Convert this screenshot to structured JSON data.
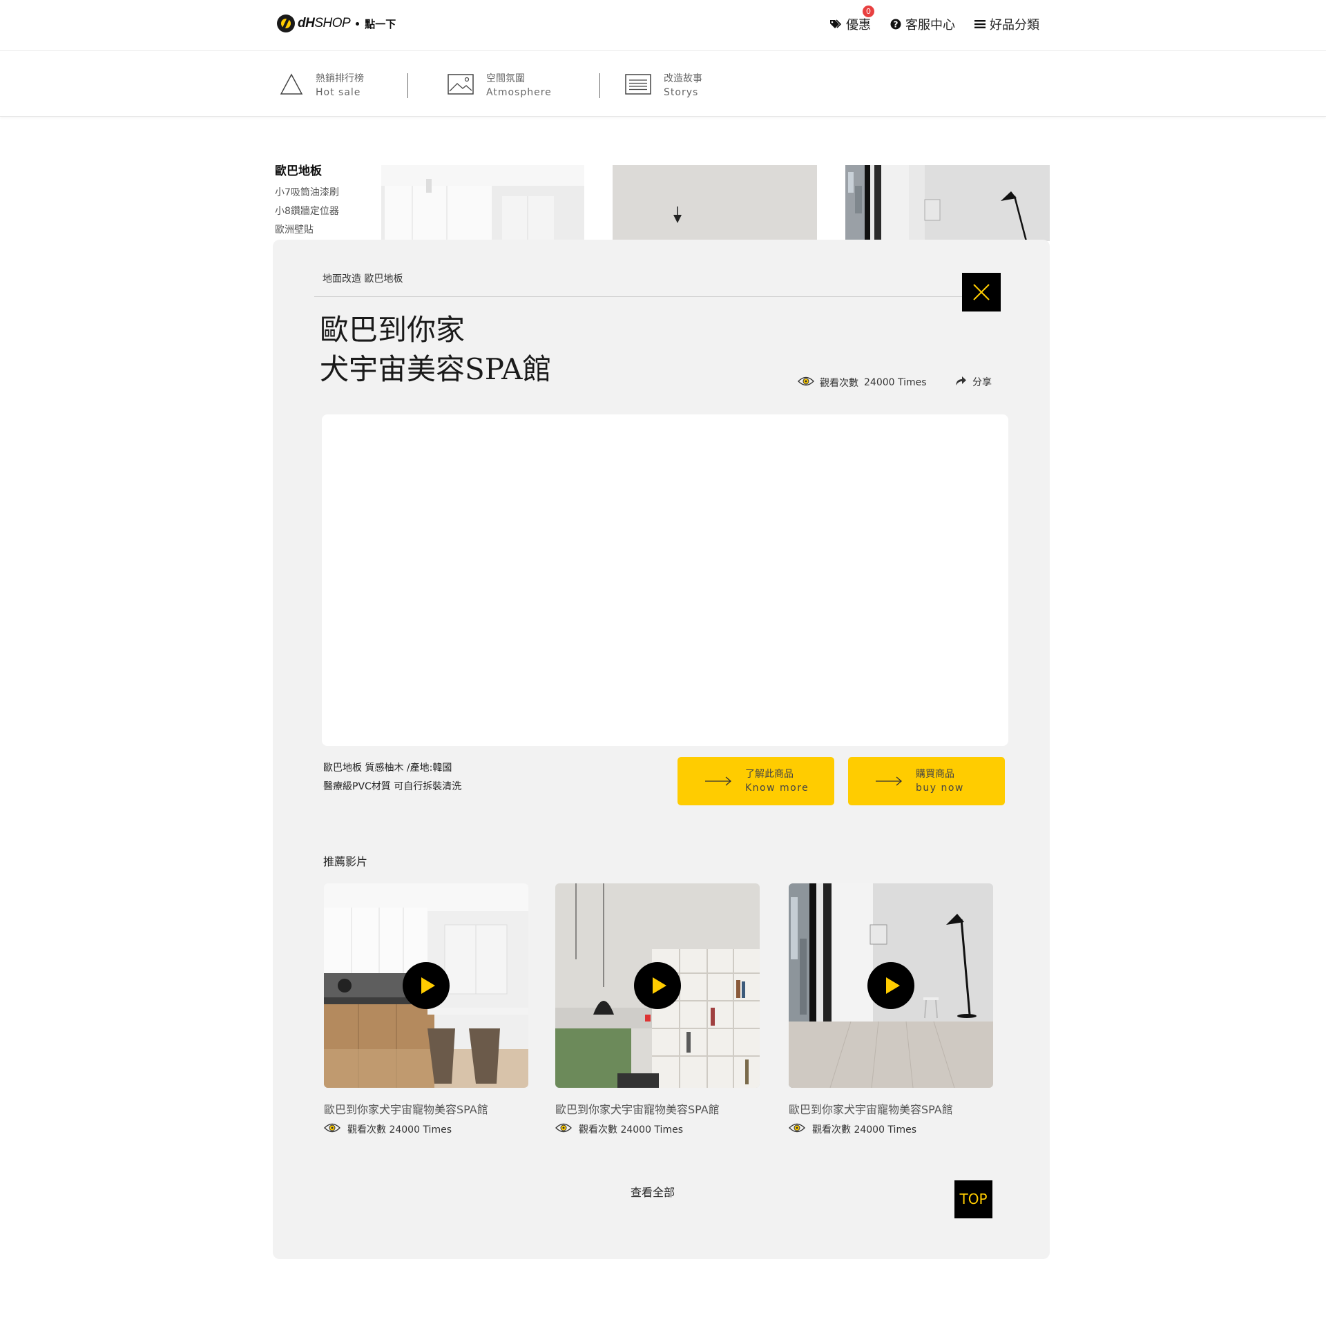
{
  "header": {
    "logo_brand": "dH",
    "logo_shop": "SHOP",
    "logo_sub": "點一下",
    "nav": [
      {
        "label": "優惠",
        "icon": "tag-icon",
        "badge": "0"
      },
      {
        "label": "客服中心",
        "icon": "question-icon"
      },
      {
        "label": "好品分類",
        "icon": "menu-icon"
      }
    ]
  },
  "categories": [
    {
      "zh": "熱銷排行榜",
      "en": "Hot sale",
      "icon": "triangle-icon"
    },
    {
      "zh": "空間氛圍",
      "en": "Atmosphere",
      "icon": "image-icon"
    },
    {
      "zh": "改造故事",
      "en": "Storys",
      "icon": "list-icon"
    }
  ],
  "sidebar": {
    "title": "歐巴地板",
    "items": [
      "小7吸筒油漆刷",
      "小8鑽牆定位器",
      "歐洲壁貼"
    ]
  },
  "modal": {
    "breadcrumb": "地面改造 歐巴地板",
    "title_line1": "歐巴到你家",
    "title_line2": "犬宇宙美容SPA館",
    "views_label": "觀看次數",
    "views_value": "24000 Times",
    "share_label": "分享",
    "desc_line1": "歐巴地板 質感柚木 /產地:韓國",
    "desc_line2": "醫療級PVC材質 可自行拆裝清洗",
    "cta_more_zh": "了解此商品",
    "cta_more_en": "Know more",
    "cta_buy_zh": "購買商品",
    "cta_buy_en": "buy now",
    "rec_heading": "推薦影片",
    "cards": [
      {
        "title": "歐巴到你家犬宇宙寵物美容SPA館",
        "views": "觀看次數 24000 Times"
      },
      {
        "title": "歐巴到你家犬宇宙寵物美容SPA館",
        "views": "觀看次數 24000 Times"
      },
      {
        "title": "歐巴到你家犬宇宙寵物美容SPA館",
        "views": "觀看次數 24000 Times"
      }
    ],
    "view_all": "查看全部",
    "top": "TOP"
  },
  "colors": {
    "accent": "#ffcc00",
    "dark": "#000000",
    "modal_bg": "#f2f2f2",
    "badge": "#e84040"
  }
}
